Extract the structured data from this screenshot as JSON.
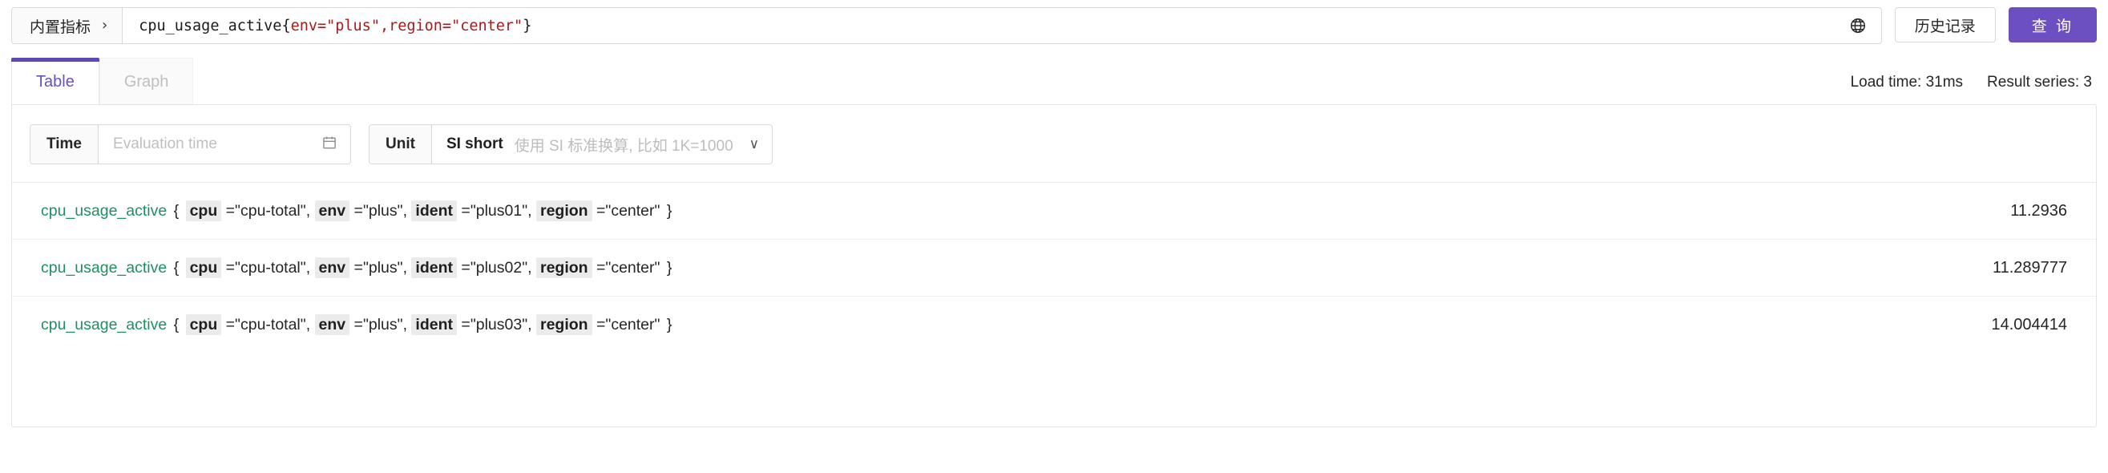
{
  "query_bar": {
    "metric_picker_label": "内置指标",
    "metric_picker_chevron": "chevron-right-icon",
    "expression": {
      "metric": "cpu_usage_active",
      "open_brace": "{",
      "matchers": [
        {
          "text": "env=\"plus\""
        },
        {
          "sep": ", ",
          "text": "region=\"center\""
        }
      ],
      "close_brace": "}",
      "full_text": "cpu_usage_active{env=\"plus\", region=\"center\"}"
    },
    "globe_icon": "globe-icon",
    "history_button": "历史记录",
    "query_button": "查 询"
  },
  "tabs": [
    {
      "label": "Table",
      "active": true
    },
    {
      "label": "Graph",
      "active": false
    }
  ],
  "status": {
    "load_time": "Load time: 31ms",
    "result_series": "Result series: 3"
  },
  "controls": {
    "time": {
      "addon_label": "Time",
      "placeholder": "Evaluation time",
      "value": "",
      "calendar_icon": "calendar-icon"
    },
    "unit": {
      "addon_label": "Unit",
      "selected": "SI short",
      "description": "使用 SI 标准换算, 比如 1K=1000",
      "caret_icon": "chevron-down-icon"
    }
  },
  "results": {
    "rows": [
      {
        "metric": "cpu_usage_active",
        "labels": [
          {
            "key": "cpu",
            "value": "\"cpu-total\""
          },
          {
            "key": "env",
            "value": "\"plus\""
          },
          {
            "key": "ident",
            "value": "\"plus01\""
          },
          {
            "key": "region",
            "value": "\"center\""
          }
        ],
        "value": "11.2936"
      },
      {
        "metric": "cpu_usage_active",
        "labels": [
          {
            "key": "cpu",
            "value": "\"cpu-total\""
          },
          {
            "key": "env",
            "value": "\"plus\""
          },
          {
            "key": "ident",
            "value": "\"plus02\""
          },
          {
            "key": "region",
            "value": "\"center\""
          }
        ],
        "value": "11.289777"
      },
      {
        "metric": "cpu_usage_active",
        "labels": [
          {
            "key": "cpu",
            "value": "\"cpu-total\""
          },
          {
            "key": "env",
            "value": "\"plus\""
          },
          {
            "key": "ident",
            "value": "\"plus03\""
          },
          {
            "key": "region",
            "value": "\"center\""
          }
        ],
        "value": "14.004414"
      }
    ]
  },
  "colors": {
    "primary": "#6c4fc0",
    "tab_active_text": "#6c4fc0",
    "metric_green": "#1e9060",
    "matcher_red": "#a61c1c",
    "border": "#d9d9d9"
  }
}
